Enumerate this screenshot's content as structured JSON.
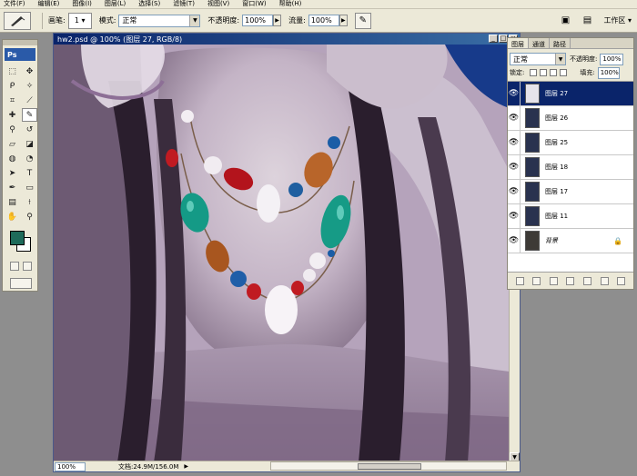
{
  "menu": [
    "文件(F)",
    "编辑(E)",
    "图像(I)",
    "图层(L)",
    "选择(S)",
    "滤镜(T)",
    "视图(V)",
    "窗口(W)",
    "帮助(H)"
  ],
  "options": {
    "brush_label": "画笔:",
    "brush_size": "1",
    "mode_label": "模式:",
    "mode_value": "正常",
    "opacity_label": "不透明度:",
    "opacity_value": "100%",
    "flow_label": "流量:",
    "flow_value": "100%",
    "workspace_label": "工作区 ▾"
  },
  "document": {
    "title": "hw2.psd @ 100% (图层 27, RGB/8)",
    "zoom": "100%",
    "doc_info": "文档:24.9M/156.0M"
  },
  "toolbox": {
    "logo": "Ps",
    "foreground_color": "#1e6b5a",
    "background_color": "#ffffff"
  },
  "layers_panel": {
    "tabs": [
      "图层",
      "通道",
      "路径"
    ],
    "blend_mode": "正常",
    "opacity_label": "不透明度:",
    "opacity_value": "100%",
    "lock_label": "锁定:",
    "fill_label": "填充:",
    "fill_value": "100%",
    "layers": [
      {
        "name": "图层 27",
        "selected": true
      },
      {
        "name": "图层 26",
        "selected": false
      },
      {
        "name": "图层 25",
        "selected": false
      },
      {
        "name": "图层 18",
        "selected": false
      },
      {
        "name": "图层 17",
        "selected": false
      },
      {
        "name": "图层 11",
        "selected": false
      },
      {
        "name": "背景",
        "selected": false
      }
    ]
  }
}
